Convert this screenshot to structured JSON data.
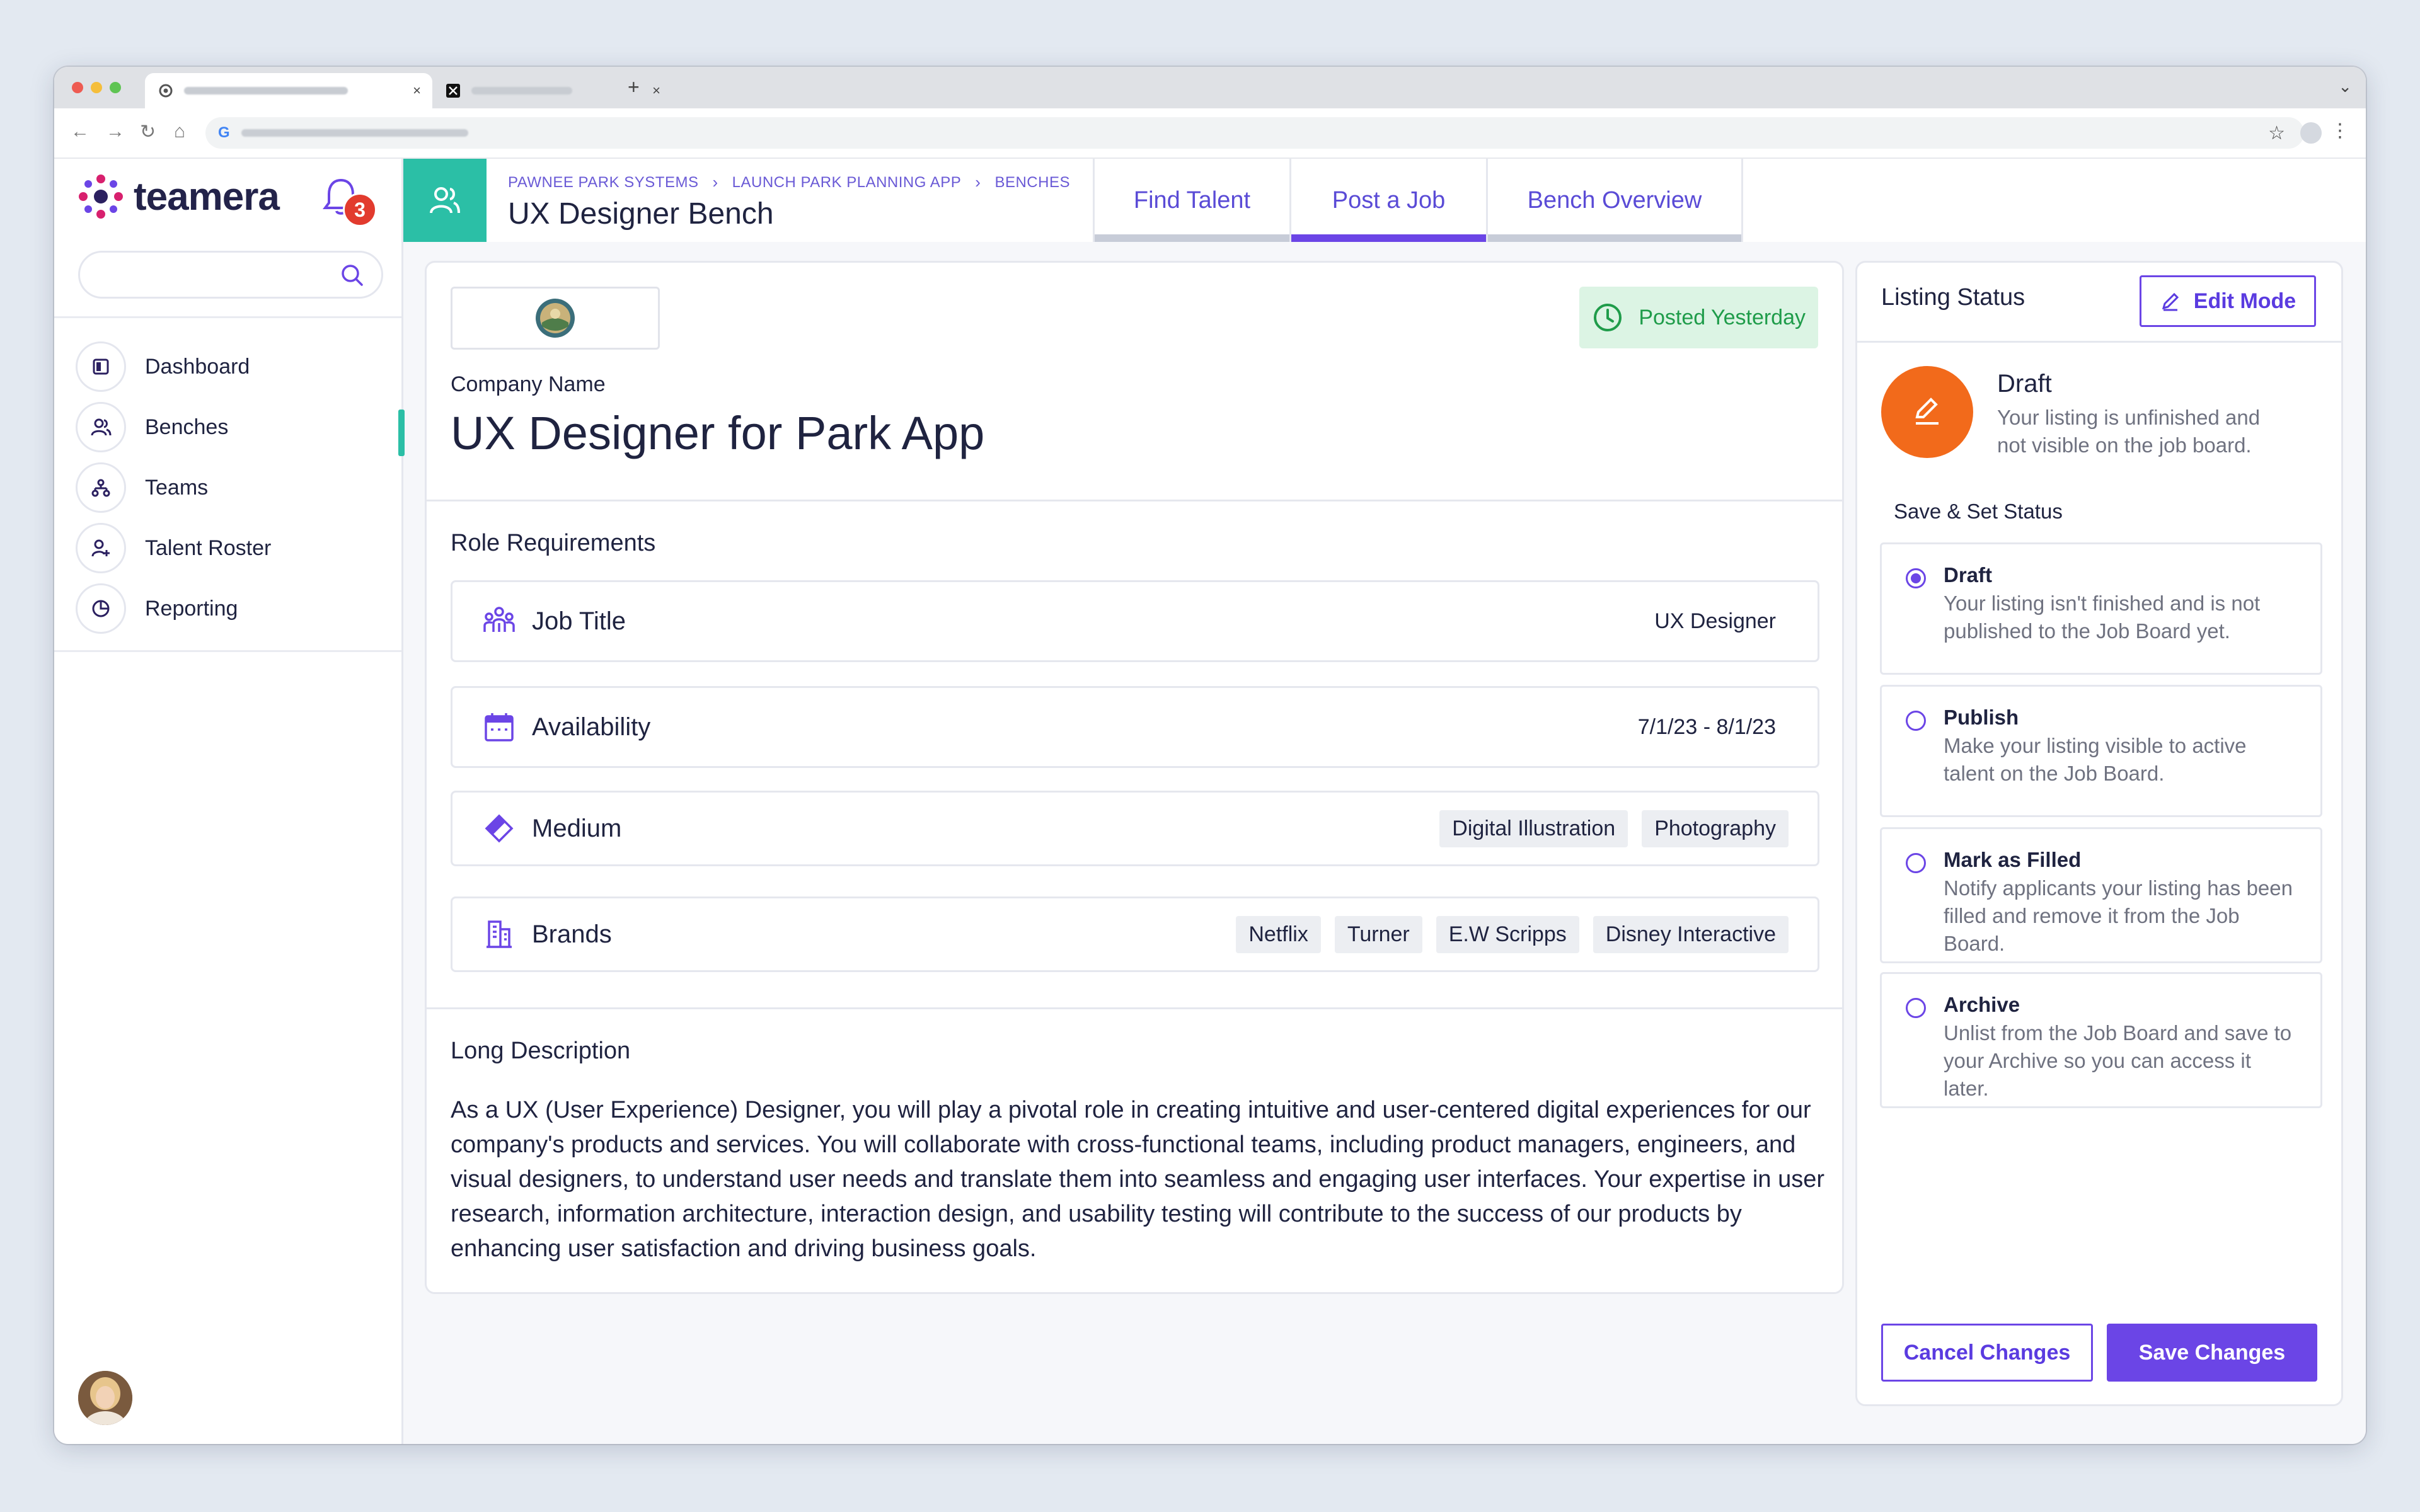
{
  "browser": {
    "tab_active_icon": "chrome-icon",
    "tab_second_icon": "x-logo-icon",
    "new_tab": "+",
    "google_g": "G"
  },
  "brand": {
    "name": "teamera",
    "notification_count": "3"
  },
  "search": {
    "placeholder": ""
  },
  "sidebar": {
    "items": [
      {
        "label": "Dashboard",
        "icon": "dashboard-icon"
      },
      {
        "label": "Benches",
        "icon": "people-icon",
        "active": true
      },
      {
        "label": "Teams",
        "icon": "org-chart-icon"
      },
      {
        "label": "Talent Roster",
        "icon": "user-add-icon"
      },
      {
        "label": "Reporting",
        "icon": "pie-chart-icon"
      }
    ]
  },
  "header": {
    "breadcrumbs": [
      "PAWNEE PARK SYSTEMS",
      "LAUNCH PARK PLANNING APP",
      "BENCHES"
    ],
    "title": "UX Designer Bench",
    "tabs": [
      "Find Talent",
      "Post a Job",
      "Bench Overview"
    ],
    "active_tab": "Post a Job"
  },
  "job": {
    "status_badge": "Posted Yesterday",
    "company_label": "Company Name",
    "title": "UX Designer for Park App",
    "role_requirements_title": "Role Requirements",
    "requirements": {
      "job_title": {
        "label": "Job Title",
        "value": "UX Designer"
      },
      "availability": {
        "label": "Availability",
        "value": "7/1/23 - 8/1/23"
      },
      "medium": {
        "label": "Medium",
        "values": [
          "Digital Illustration",
          "Photography"
        ]
      },
      "brands": {
        "label": "Brands",
        "values": [
          "Netflix",
          "Turner",
          "E.W Scripps",
          "Disney Interactive"
        ]
      }
    },
    "long_description_title": "Long Description",
    "long_description": "As a UX (User Experience) Designer, you will play a pivotal role in creating intuitive and user-centered digital experiences for our company's products and services. You will collaborate with cross-functional teams, including product managers, engineers, and visual designers, to understand user needs and translate them into seamless and engaging user interfaces. Your expertise in user research, information architecture, interaction design, and usability testing will contribute to the success of our products by enhancing user satisfaction and driving business goals."
  },
  "listing": {
    "title": "Listing Status",
    "edit_button": "Edit Mode",
    "current_status": "Draft",
    "current_desc": "Your listing is unfinished and not visible on the job board.",
    "save_set_title": "Save & Set Status",
    "options": [
      {
        "title": "Draft",
        "desc": "Your listing isn't finished and is not published to the Job Board yet.",
        "selected": true
      },
      {
        "title": "Publish",
        "desc": "Make your listing visible to active talent on the Job Board.",
        "selected": false
      },
      {
        "title": "Mark as Filled",
        "desc": "Notify applicants your listing has been filled and remove it from the Job Board.",
        "selected": false
      },
      {
        "title": "Archive",
        "desc": "Unlist from the Job Board and save to your Archive so you can access it later.",
        "selected": false
      }
    ],
    "cancel_button": "Cancel Changes",
    "save_button": "Save Changes"
  },
  "colors": {
    "accent": "#6b45e6",
    "teal": "#2bbfa6",
    "draft_orange": "#f26a1b",
    "posted_green": "#1f9c4a",
    "badge_red": "#e23b2e"
  }
}
